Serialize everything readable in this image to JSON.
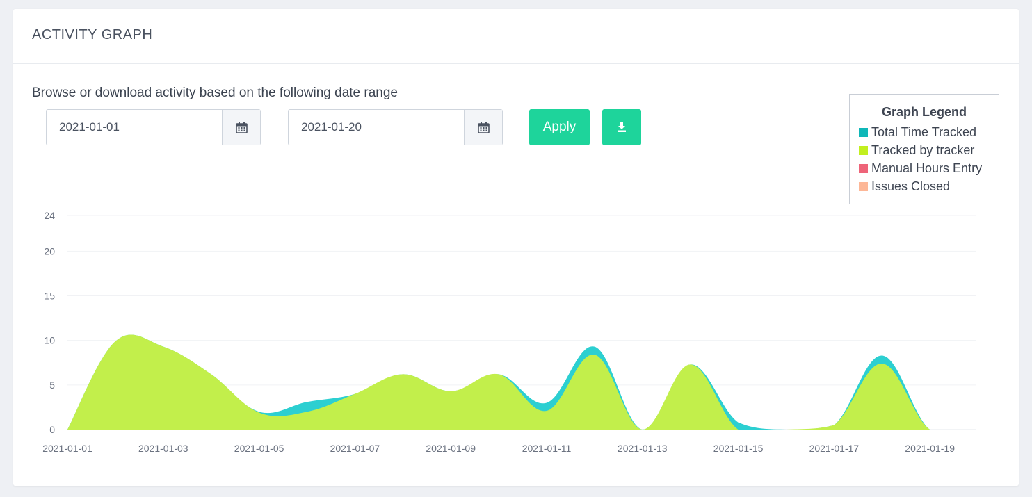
{
  "card": {
    "title": "ACTIVITY GRAPH",
    "subtitle": "Browse or download activity based on the following date range"
  },
  "filters": {
    "start_date": "2021-01-01",
    "end_date": "2021-01-20",
    "calendar_icon": "calendar-icon",
    "apply_label": "Apply",
    "download_icon": "download-icon"
  },
  "colors": {
    "accent": "#1ed49b",
    "total_time": "#2ccfd1",
    "tracked_by_tracker": "#c2ef4b",
    "manual_hours": "#ee6479",
    "issues_closed": "#fdb797"
  },
  "legend": {
    "title": "Graph Legend",
    "items": [
      {
        "label": "Total Time Tracked",
        "color": "#0fb7b8"
      },
      {
        "label": "Tracked by tracker",
        "color": "#c2ef1f"
      },
      {
        "label": "Manual Hours Entry",
        "color": "#ee6479"
      },
      {
        "label": "Issues Closed",
        "color": "#fdb797"
      }
    ]
  },
  "chart_data": {
    "type": "area",
    "x": [
      "2021-01-01",
      "2021-01-02",
      "2021-01-03",
      "2021-01-04",
      "2021-01-05",
      "2021-01-06",
      "2021-01-07",
      "2021-01-08",
      "2021-01-09",
      "2021-01-10",
      "2021-01-11",
      "2021-01-12",
      "2021-01-13",
      "2021-01-14",
      "2021-01-15",
      "2021-01-16",
      "2021-01-17",
      "2021-01-18",
      "2021-01-19",
      "2021-01-20"
    ],
    "x_tick_labels": [
      "2021-01-01",
      "2021-01-03",
      "2021-01-05",
      "2021-01-07",
      "2021-01-09",
      "2021-01-11",
      "2021-01-13",
      "2021-01-15",
      "2021-01-17",
      "2021-01-19"
    ],
    "y_ticks": [
      0,
      5,
      10,
      15,
      20,
      24
    ],
    "ylim": [
      0,
      24
    ],
    "grid": true,
    "series": [
      {
        "name": "Total Time Tracked",
        "values": [
          0,
          9.9,
          9.3,
          6.2,
          2.0,
          3.1,
          4.0,
          6.2,
          4.3,
          6.2,
          3.0,
          9.3,
          0,
          7.3,
          0.8,
          0,
          0.5,
          8.3,
          0,
          0
        ]
      },
      {
        "name": "Tracked by tracker",
        "values": [
          0,
          9.9,
          9.3,
          6.2,
          1.9,
          2.0,
          4.0,
          6.2,
          4.3,
          6.2,
          2.1,
          8.4,
          0,
          7.3,
          0,
          0,
          0.5,
          7.4,
          0,
          0
        ]
      }
    ]
  }
}
